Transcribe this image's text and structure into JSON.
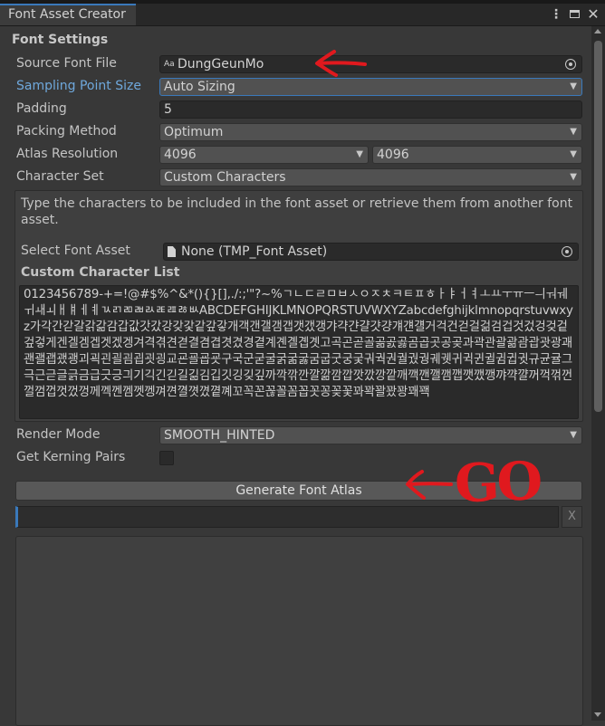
{
  "window": {
    "tab_title": "Font Asset Creator"
  },
  "section": {
    "title": "Font Settings"
  },
  "fields": {
    "source_font_file": {
      "label": "Source Font File",
      "value": "DungGeunMo",
      "font_icon_text": "Aa"
    },
    "sampling_point_size": {
      "label": "Sampling Point Size",
      "value": "Auto Sizing"
    },
    "padding": {
      "label": "Padding",
      "value": "5"
    },
    "packing_method": {
      "label": "Packing Method",
      "value": "Optimum"
    },
    "atlas_resolution": {
      "label": "Atlas Resolution",
      "width": "4096",
      "height": "4096"
    },
    "character_set": {
      "label": "Character Set",
      "value": "Custom Characters"
    }
  },
  "custom_chars": {
    "help": "Type the characters to be included in the font asset or retrieve them from another font asset.",
    "select_label": "Select Font Asset",
    "select_value": "None (TMP_Font Asset)",
    "list_label": "Custom Character List",
    "list_value": "0123456789-+=!@#$%^&*(){}[],./:;'\"?~%ㄱㄴㄷㄹㅁㅂㅅㅇㅈㅊㅋㅌㅍㅎㅏㅑㅓㅕㅗㅛㅜㅠㅡㅢㅝㅞㅟㅙㅚㅐㅒㅔㅖㄳㄺㄻㄼㄽㄾㄿㅀㅄABCDEFGHIJKLMNOPQRSTUVWXYZabcdefghijklmnopqrstuvwxyz가각간갇갈갉갊감갑값갓갔강갖갗같갚갛개객갠갤갬갭갯갰갱갸갹갼걀걋걍걔걘걜거걱건걷걸걺검겁것겄겅겆겉겊겋게겐겔겜겝겟겠겡겨격겪견겯결겸겹겻겼경곁계곈곌곕곗고곡곤곧골곪곬곯곰곱곳공곶과곽관괄괆괌괍괏광괘괜괠괩괬괭괴괵괸괼굄굅굇굉교굔굘굡굣구국군굳굴굵굶굻굼굽굿궁궂궈궉권궐궜궝궤궷귀귁귄귈귐귑귓규균귤그극근귿글긁금급긋긍긔기긱긴긷길긺김깁깃깅깆깊까깍깎깐깔깖깜깝깟깠깡깥깨깩깬깰깸깹깻깼깽꺄꺅꺌꺼꺽꺾껀껄껌껍껏껐껑께껙껜껨껫껭껴껸껼꼇꼈꼍꼐꼬꼭꼰꼲꼴꼼꼽꼿꽁꽂꽃꽈꽉꽐꽜꽝꽤꽥"
  },
  "render_mode": {
    "label": "Render Mode",
    "value": "SMOOTH_HINTED"
  },
  "kerning": {
    "label": "Get Kerning Pairs",
    "checked": false
  },
  "generate_button": {
    "label": "Generate Font Atlas"
  },
  "progress": {
    "value": 0,
    "clear_label": "X"
  },
  "annotation": {
    "text": "GO",
    "color": "#e0191e"
  },
  "colors": {
    "accent": "#3a79bb",
    "highlight_label": "#6fa8dc",
    "bg": "#383838"
  }
}
